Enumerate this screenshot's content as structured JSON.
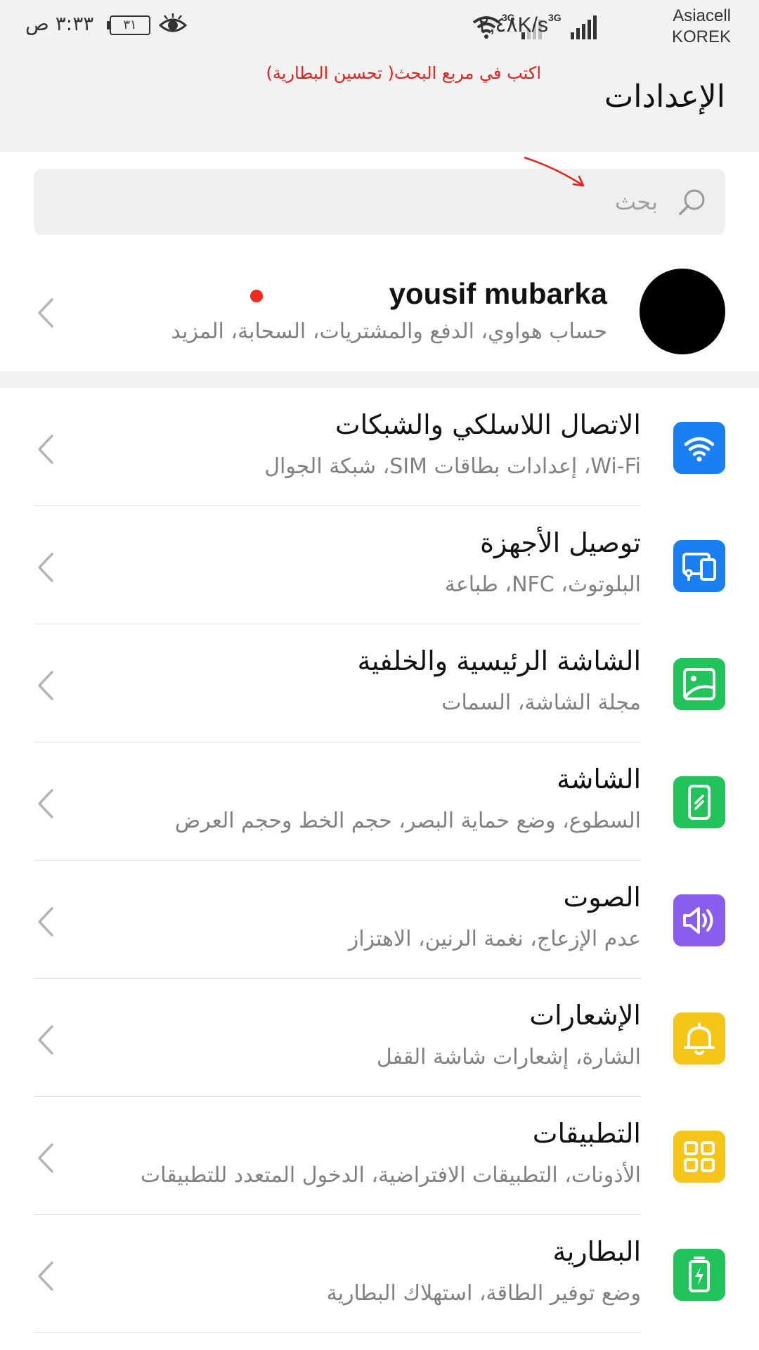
{
  "status_bar": {
    "carrier_1": "Asiacell",
    "carrier_2": "KOREK",
    "network_type_1": "3G",
    "network_type_2": "3G",
    "speed": "٢,٤٨K/s",
    "time": "٣:٣٣ ص",
    "battery_level": "٣١",
    "icons": [
      "eye-comfort-icon",
      "battery-icon",
      "wifi-icon",
      "signal-icon"
    ]
  },
  "header": {
    "title": "الإعدادات"
  },
  "annotation": {
    "text": "اكتب في مربع البحث( تحسين البطارية)",
    "color": "#e0211b"
  },
  "search": {
    "placeholder": "بحث",
    "icon": "search-icon"
  },
  "account": {
    "name": "yousif mubarka",
    "subtitle": "حساب هواوي، الدفع والمشتريات، السحابة، المزيد",
    "notification_dot_color": "#f0281e"
  },
  "settings": [
    {
      "title": "الاتصال اللاسلكي والشبكات",
      "subtitle": "Wi-Fi، إعدادات بطاقات SIM، شبكة الجوال",
      "icon": "wifi-icon",
      "color": "#1a7ff2"
    },
    {
      "title": "توصيل الأجهزة",
      "subtitle": "البلوتوث، NFC، طباعة",
      "icon": "device-connection-icon",
      "color": "#1a7ff2"
    },
    {
      "title": "الشاشة الرئيسية والخلفية",
      "subtitle": "مجلة الشاشة، السمات",
      "icon": "wallpaper-icon",
      "color": "#22c35a"
    },
    {
      "title": "الشاشة",
      "subtitle": "السطوع، وضع حماية البصر، حجم الخط وحجم العرض",
      "icon": "display-icon",
      "color": "#22c35a"
    },
    {
      "title": "الصوت",
      "subtitle": "عدم الإزعاج، نغمة الرنين، الاهتزاز",
      "icon": "sound-icon",
      "color": "#8a5cf0"
    },
    {
      "title": "الإشعارات",
      "subtitle": "الشارة، إشعارات شاشة القفل",
      "icon": "bell-icon",
      "color": "#f5c51a"
    },
    {
      "title": "التطبيقات",
      "subtitle": "الأذونات، التطبيقات الافتراضية، الدخول المتعدد للتطبيقات",
      "icon": "apps-icon",
      "color": "#f5c51a"
    },
    {
      "title": "البطارية",
      "subtitle": "وضع توفير الطاقة، استهلاك البطارية",
      "icon": "battery-icon",
      "color": "#22c35a"
    }
  ]
}
